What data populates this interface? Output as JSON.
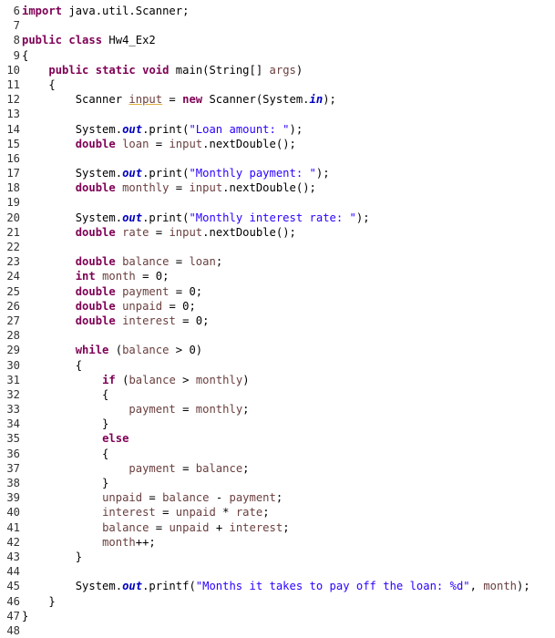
{
  "editor": {
    "language": "java",
    "colors": {
      "keyword": "#7f0055",
      "string": "#2a00ff",
      "local_variable": "#6a3e3e",
      "static_field": "#0000c0",
      "default": "#000000",
      "warning_underline": "#e0b040"
    },
    "lines": [
      {
        "n": "6",
        "tokens": [
          {
            "t": "kw",
            "v": "import"
          },
          {
            "t": "",
            "v": " java.util.Scanner;"
          }
        ]
      },
      {
        "n": "7",
        "tokens": []
      },
      {
        "n": "8",
        "tokens": [
          {
            "t": "kw",
            "v": "public"
          },
          {
            "t": "",
            "v": " "
          },
          {
            "t": "kw",
            "v": "class"
          },
          {
            "t": "",
            "v": " Hw4_Ex2"
          }
        ]
      },
      {
        "n": "9",
        "tokens": [
          {
            "t": "",
            "v": "{"
          }
        ]
      },
      {
        "n": "10",
        "tokens": [
          {
            "t": "",
            "v": "    "
          },
          {
            "t": "kw",
            "v": "public"
          },
          {
            "t": "",
            "v": " "
          },
          {
            "t": "kw",
            "v": "static"
          },
          {
            "t": "",
            "v": " "
          },
          {
            "t": "kw",
            "v": "void"
          },
          {
            "t": "",
            "v": " main(String[] "
          },
          {
            "t": "var",
            "v": "args"
          },
          {
            "t": "",
            "v": ")"
          }
        ]
      },
      {
        "n": "11",
        "tokens": [
          {
            "t": "",
            "v": "    {"
          }
        ]
      },
      {
        "n": "12",
        "tokens": [
          {
            "t": "",
            "v": "        Scanner "
          },
          {
            "t": "var warn",
            "v": "input"
          },
          {
            "t": "",
            "v": " = "
          },
          {
            "t": "kw",
            "v": "new"
          },
          {
            "t": "",
            "v": " Scanner(System."
          },
          {
            "t": "fld",
            "v": "in"
          },
          {
            "t": "",
            "v": ");"
          }
        ]
      },
      {
        "n": "13",
        "tokens": []
      },
      {
        "n": "14",
        "tokens": [
          {
            "t": "",
            "v": "        System."
          },
          {
            "t": "fld",
            "v": "out"
          },
          {
            "t": "",
            "v": ".print("
          },
          {
            "t": "str",
            "v": "\"Loan amount: \""
          },
          {
            "t": "",
            "v": ");"
          }
        ]
      },
      {
        "n": "15",
        "tokens": [
          {
            "t": "",
            "v": "        "
          },
          {
            "t": "kw",
            "v": "double"
          },
          {
            "t": "",
            "v": " "
          },
          {
            "t": "var",
            "v": "loan"
          },
          {
            "t": "",
            "v": " = "
          },
          {
            "t": "var",
            "v": "input"
          },
          {
            "t": "",
            "v": ".nextDouble();"
          }
        ]
      },
      {
        "n": "16",
        "tokens": []
      },
      {
        "n": "17",
        "tokens": [
          {
            "t": "",
            "v": "        System."
          },
          {
            "t": "fld",
            "v": "out"
          },
          {
            "t": "",
            "v": ".print("
          },
          {
            "t": "str",
            "v": "\"Monthly payment: \""
          },
          {
            "t": "",
            "v": ");"
          }
        ]
      },
      {
        "n": "18",
        "tokens": [
          {
            "t": "",
            "v": "        "
          },
          {
            "t": "kw",
            "v": "double"
          },
          {
            "t": "",
            "v": " "
          },
          {
            "t": "var",
            "v": "monthly"
          },
          {
            "t": "",
            "v": " = "
          },
          {
            "t": "var",
            "v": "input"
          },
          {
            "t": "",
            "v": ".nextDouble();"
          }
        ]
      },
      {
        "n": "19",
        "tokens": []
      },
      {
        "n": "20",
        "tokens": [
          {
            "t": "",
            "v": "        System."
          },
          {
            "t": "fld",
            "v": "out"
          },
          {
            "t": "",
            "v": ".print("
          },
          {
            "t": "str",
            "v": "\"Monthly interest rate: \""
          },
          {
            "t": "",
            "v": ");"
          }
        ]
      },
      {
        "n": "21",
        "tokens": [
          {
            "t": "",
            "v": "        "
          },
          {
            "t": "kw",
            "v": "double"
          },
          {
            "t": "",
            "v": " "
          },
          {
            "t": "var",
            "v": "rate"
          },
          {
            "t": "",
            "v": " = "
          },
          {
            "t": "var",
            "v": "input"
          },
          {
            "t": "",
            "v": ".nextDouble();"
          }
        ]
      },
      {
        "n": "22",
        "tokens": []
      },
      {
        "n": "23",
        "tokens": [
          {
            "t": "",
            "v": "        "
          },
          {
            "t": "kw",
            "v": "double"
          },
          {
            "t": "",
            "v": " "
          },
          {
            "t": "var",
            "v": "balance"
          },
          {
            "t": "",
            "v": " = "
          },
          {
            "t": "var",
            "v": "loan"
          },
          {
            "t": "",
            "v": ";"
          }
        ]
      },
      {
        "n": "24",
        "tokens": [
          {
            "t": "",
            "v": "        "
          },
          {
            "t": "kw",
            "v": "int"
          },
          {
            "t": "",
            "v": " "
          },
          {
            "t": "var",
            "v": "month"
          },
          {
            "t": "",
            "v": " = 0;"
          }
        ]
      },
      {
        "n": "25",
        "tokens": [
          {
            "t": "",
            "v": "        "
          },
          {
            "t": "kw",
            "v": "double"
          },
          {
            "t": "",
            "v": " "
          },
          {
            "t": "var",
            "v": "payment"
          },
          {
            "t": "",
            "v": " = 0;"
          }
        ]
      },
      {
        "n": "26",
        "tokens": [
          {
            "t": "",
            "v": "        "
          },
          {
            "t": "kw",
            "v": "double"
          },
          {
            "t": "",
            "v": " "
          },
          {
            "t": "var",
            "v": "unpaid"
          },
          {
            "t": "",
            "v": " = 0;"
          }
        ]
      },
      {
        "n": "27",
        "tokens": [
          {
            "t": "",
            "v": "        "
          },
          {
            "t": "kw",
            "v": "double"
          },
          {
            "t": "",
            "v": " "
          },
          {
            "t": "var",
            "v": "interest"
          },
          {
            "t": "",
            "v": " = 0;"
          }
        ]
      },
      {
        "n": "28",
        "tokens": []
      },
      {
        "n": "29",
        "tokens": [
          {
            "t": "",
            "v": "        "
          },
          {
            "t": "kw",
            "v": "while"
          },
          {
            "t": "",
            "v": " ("
          },
          {
            "t": "var",
            "v": "balance"
          },
          {
            "t": "",
            "v": " > 0)"
          }
        ]
      },
      {
        "n": "30",
        "tokens": [
          {
            "t": "",
            "v": "        {"
          }
        ]
      },
      {
        "n": "31",
        "tokens": [
          {
            "t": "",
            "v": "            "
          },
          {
            "t": "kw",
            "v": "if"
          },
          {
            "t": "",
            "v": " ("
          },
          {
            "t": "var",
            "v": "balance"
          },
          {
            "t": "",
            "v": " > "
          },
          {
            "t": "var",
            "v": "monthly"
          },
          {
            "t": "",
            "v": ")"
          }
        ]
      },
      {
        "n": "32",
        "tokens": [
          {
            "t": "",
            "v": "            {"
          }
        ]
      },
      {
        "n": "33",
        "tokens": [
          {
            "t": "",
            "v": "                "
          },
          {
            "t": "var",
            "v": "payment"
          },
          {
            "t": "",
            "v": " = "
          },
          {
            "t": "var",
            "v": "monthly"
          },
          {
            "t": "",
            "v": ";"
          }
        ]
      },
      {
        "n": "34",
        "tokens": [
          {
            "t": "",
            "v": "            }"
          }
        ]
      },
      {
        "n": "35",
        "tokens": [
          {
            "t": "",
            "v": "            "
          },
          {
            "t": "kw",
            "v": "else"
          }
        ]
      },
      {
        "n": "36",
        "tokens": [
          {
            "t": "",
            "v": "            {"
          }
        ]
      },
      {
        "n": "37",
        "tokens": [
          {
            "t": "",
            "v": "                "
          },
          {
            "t": "var",
            "v": "payment"
          },
          {
            "t": "",
            "v": " = "
          },
          {
            "t": "var",
            "v": "balance"
          },
          {
            "t": "",
            "v": ";"
          }
        ]
      },
      {
        "n": "38",
        "tokens": [
          {
            "t": "",
            "v": "            }"
          }
        ]
      },
      {
        "n": "39",
        "tokens": [
          {
            "t": "",
            "v": "            "
          },
          {
            "t": "var",
            "v": "unpaid"
          },
          {
            "t": "",
            "v": " = "
          },
          {
            "t": "var",
            "v": "balance"
          },
          {
            "t": "",
            "v": " - "
          },
          {
            "t": "var",
            "v": "payment"
          },
          {
            "t": "",
            "v": ";"
          }
        ]
      },
      {
        "n": "40",
        "tokens": [
          {
            "t": "",
            "v": "            "
          },
          {
            "t": "var",
            "v": "interest"
          },
          {
            "t": "",
            "v": " = "
          },
          {
            "t": "var",
            "v": "unpaid"
          },
          {
            "t": "",
            "v": " * "
          },
          {
            "t": "var",
            "v": "rate"
          },
          {
            "t": "",
            "v": ";"
          }
        ]
      },
      {
        "n": "41",
        "tokens": [
          {
            "t": "",
            "v": "            "
          },
          {
            "t": "var",
            "v": "balance"
          },
          {
            "t": "",
            "v": " = "
          },
          {
            "t": "var",
            "v": "unpaid"
          },
          {
            "t": "",
            "v": " + "
          },
          {
            "t": "var",
            "v": "interest"
          },
          {
            "t": "",
            "v": ";"
          }
        ]
      },
      {
        "n": "42",
        "tokens": [
          {
            "t": "",
            "v": "            "
          },
          {
            "t": "var",
            "v": "month"
          },
          {
            "t": "",
            "v": "++;"
          }
        ]
      },
      {
        "n": "43",
        "tokens": [
          {
            "t": "",
            "v": "        }"
          }
        ]
      },
      {
        "n": "44",
        "tokens": []
      },
      {
        "n": "45",
        "tokens": [
          {
            "t": "",
            "v": "        System."
          },
          {
            "t": "fld",
            "v": "out"
          },
          {
            "t": "",
            "v": ".printf("
          },
          {
            "t": "str",
            "v": "\"Months it takes to pay off the loan: %d\""
          },
          {
            "t": "",
            "v": ", "
          },
          {
            "t": "var",
            "v": "month"
          },
          {
            "t": "",
            "v": ");"
          }
        ]
      },
      {
        "n": "46",
        "tokens": [
          {
            "t": "",
            "v": "    }"
          }
        ]
      },
      {
        "n": "47",
        "tokens": [
          {
            "t": "",
            "v": "}"
          }
        ]
      },
      {
        "n": "48",
        "tokens": []
      }
    ]
  }
}
